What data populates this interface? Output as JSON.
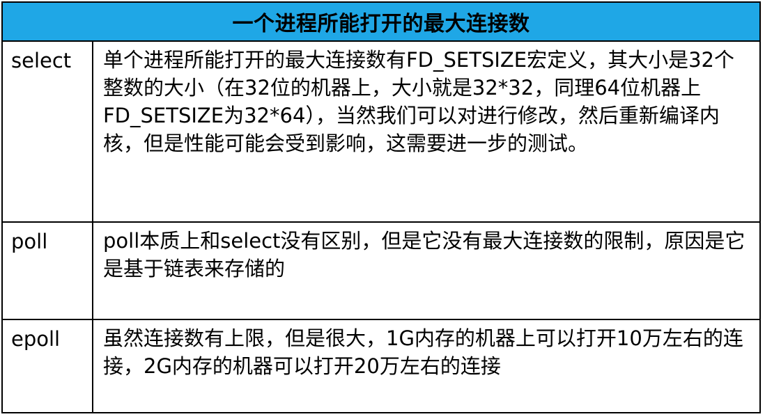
{
  "table": {
    "title": "一个进程所能打开的最大连接数",
    "rows": [
      {
        "label": "select",
        "text": "单个进程所能打开的最大连接数有FD_SETSIZE宏定义，其大小是32个整数的大小（在32位的机器上，大小就是32*32，同理64位机器上FD_SETSIZE为32*64），当然我们可以对进行修改，然后重新编译内核，但是性能可能会受到影响，这需要进一步的测试。"
      },
      {
        "label": "poll",
        "text": "poll本质上和select没有区别，但是它没有最大连接数的限制，原因是它是基于链表来存储的"
      },
      {
        "label": "epoll",
        "text": "虽然连接数有上限，但是很大，1G内存的机器上可以打开10万左右的连接，2G内存的机器可以打开20万左右的连接"
      }
    ]
  },
  "colors": {
    "header_bg": "#1fa7e6",
    "border": "#000000"
  }
}
